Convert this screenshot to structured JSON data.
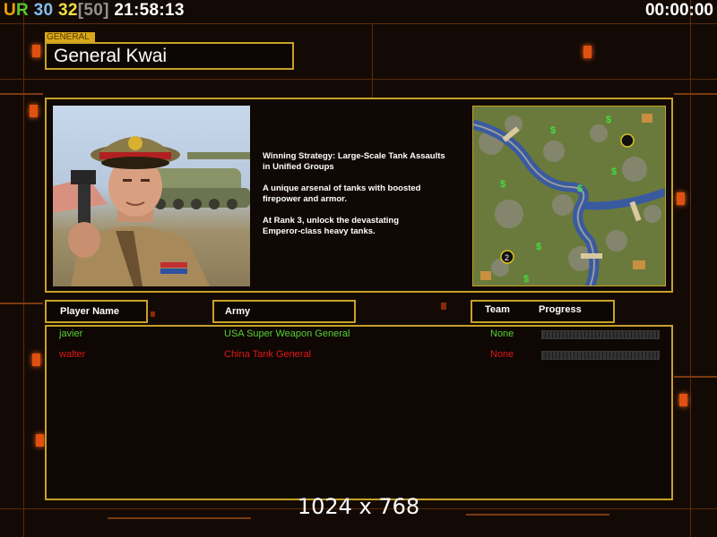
{
  "hud": {
    "prefix": "UR",
    "fps_a": "30",
    "fps_b": "32",
    "fps_limit": "[50]",
    "clock": "21:58:13",
    "timer": "00:00:00"
  },
  "general": {
    "section_label": "GENERAL",
    "name": "General Kwai"
  },
  "description": [
    "Winning Strategy: Large-Scale Tank Assaults\n in Unified Groups",
    "A unique arsenal of tanks with boosted\n firepower and armor.",
    "At Rank 3, unlock the devastating\n Emperor-class heavy tanks."
  ],
  "minimap": {
    "player_slot_1": "1",
    "player_slot_2": "2"
  },
  "table": {
    "headers": {
      "player_name": "Player Name",
      "army": "Army",
      "team": "Team",
      "progress": "Progress"
    },
    "rows": [
      {
        "player": "javier",
        "army": "USA Super Weapon General",
        "team": "None",
        "color": "#58d038"
      },
      {
        "player": "walter",
        "army": "China Tank General",
        "team": "None",
        "color": "#e01818"
      }
    ]
  },
  "resolution_text": "1024 x 768",
  "colors": {
    "gold": "#c8a028",
    "accent_orange": "#e05010",
    "hud_ur_u": "#f0a000",
    "hud_ur_r": "#58c830",
    "hud_fps_a": "#80c0f0",
    "hud_fps_b": "#f0e040",
    "hud_fps_limit": "#909090"
  }
}
